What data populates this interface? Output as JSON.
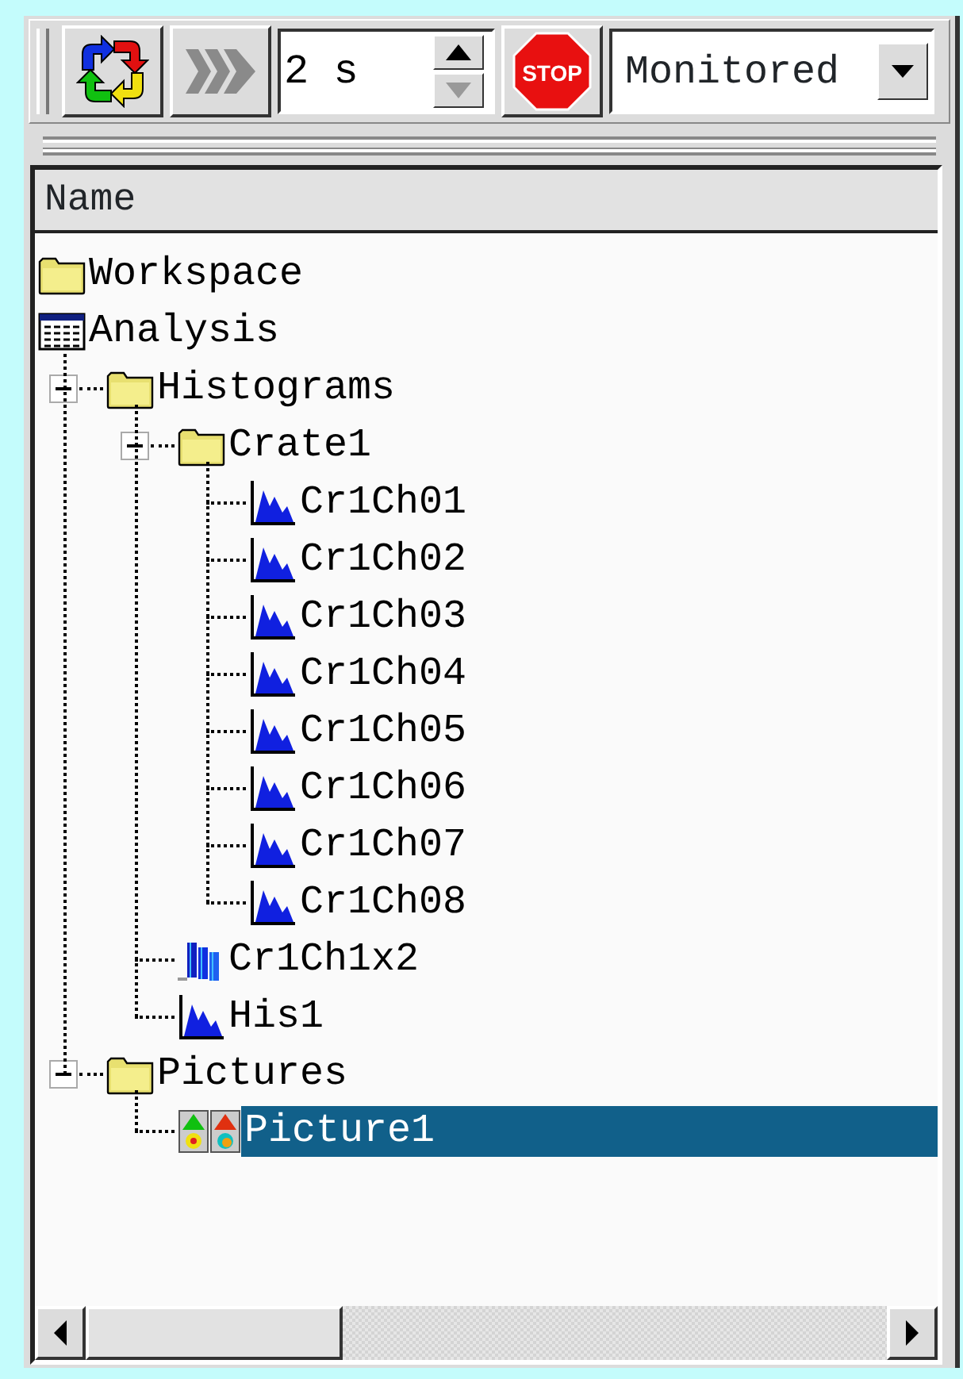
{
  "toolbar": {
    "refresh_button": {
      "disabled": false
    },
    "forward_button": {
      "disabled": true
    },
    "interval": {
      "value": "2 s"
    },
    "stop_button": {
      "label": "STOP"
    },
    "mode_select": {
      "value": "Monitored"
    }
  },
  "tree": {
    "columns": [
      "Name"
    ],
    "items": [
      {
        "label": "Workspace",
        "kind": "folder",
        "selected": false
      },
      {
        "label": "Analysis",
        "kind": "analysis",
        "selected": false,
        "children": [
          {
            "label": "Histograms",
            "kind": "folder",
            "selected": false,
            "expanded": true,
            "children": [
              {
                "label": "Crate1",
                "kind": "folder",
                "selected": false,
                "expanded": true,
                "children": [
                  {
                    "label": "Cr1Ch01",
                    "kind": "histogram",
                    "selected": false
                  },
                  {
                    "label": "Cr1Ch02",
                    "kind": "histogram",
                    "selected": false
                  },
                  {
                    "label": "Cr1Ch03",
                    "kind": "histogram",
                    "selected": false
                  },
                  {
                    "label": "Cr1Ch04",
                    "kind": "histogram",
                    "selected": false
                  },
                  {
                    "label": "Cr1Ch05",
                    "kind": "histogram",
                    "selected": false
                  },
                  {
                    "label": "Cr1Ch06",
                    "kind": "histogram",
                    "selected": false
                  },
                  {
                    "label": "Cr1Ch07",
                    "kind": "histogram",
                    "selected": false
                  },
                  {
                    "label": "Cr1Ch08",
                    "kind": "histogram",
                    "selected": false
                  }
                ]
              },
              {
                "label": "Cr1Ch1x2",
                "kind": "histogram2d",
                "selected": false
              },
              {
                "label": "His1",
                "kind": "histogram",
                "selected": false
              }
            ]
          },
          {
            "label": "Pictures",
            "kind": "folder",
            "selected": false,
            "expanded": true,
            "children": [
              {
                "label": "Picture1",
                "kind": "picture",
                "selected": true
              }
            ]
          }
        ]
      }
    ]
  }
}
